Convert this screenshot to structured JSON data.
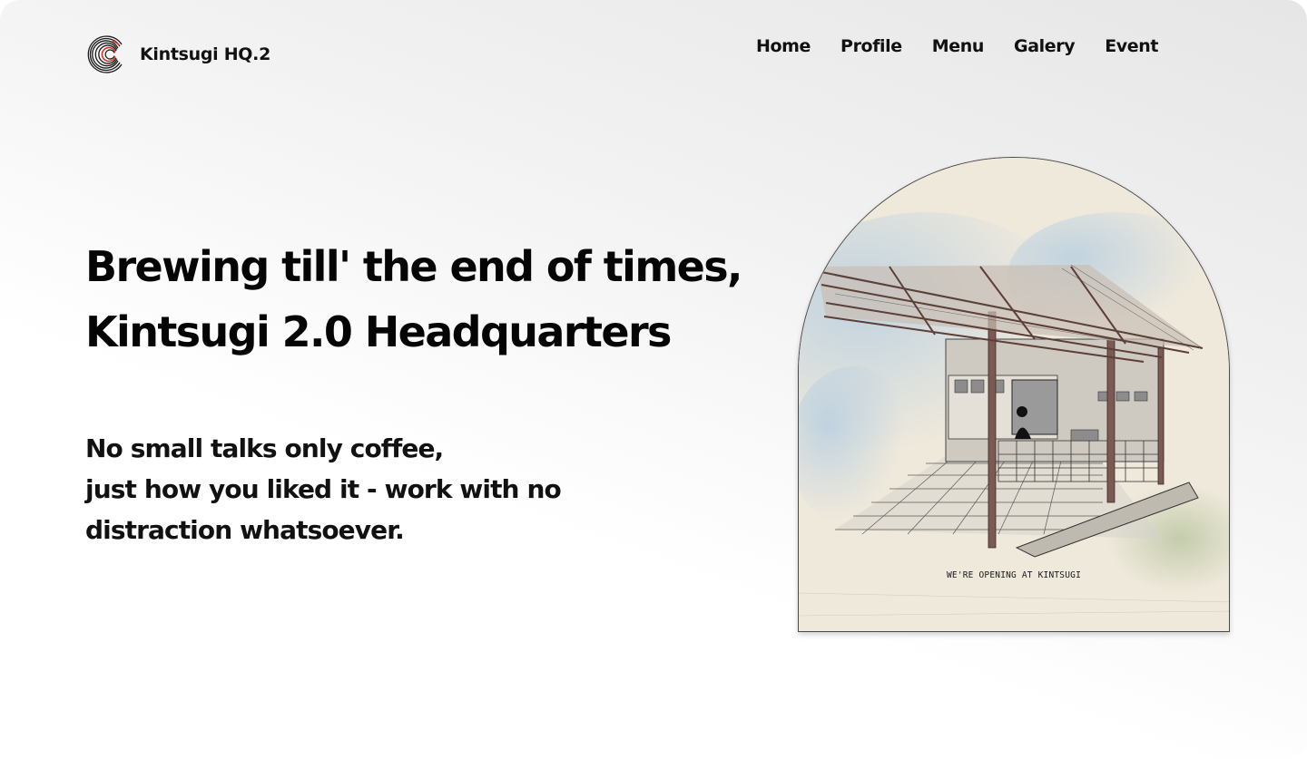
{
  "brand": {
    "name": "Kintsugi HQ.2",
    "logo_icon": "concentric-arc-logo-icon"
  },
  "nav": {
    "items": [
      {
        "label": "Home"
      },
      {
        "label": "Profile"
      },
      {
        "label": "Menu"
      },
      {
        "label": "Galery"
      },
      {
        "label": "Event"
      }
    ]
  },
  "hero": {
    "title_line1": "Brewing till' the end of times,",
    "title_line2": "Kintsugi 2.0 Headquarters",
    "sub_line1": "No small talks only coffee,",
    "sub_line2": "just how you liked it - work with no",
    "sub_line3": "distraction whatsoever."
  },
  "illustration": {
    "caption": "WE'RE OPENING AT KINTSUGI"
  },
  "colors": {
    "text": "#111111",
    "accent_red": "#d23a2a",
    "paper": "#efe9dc"
  }
}
